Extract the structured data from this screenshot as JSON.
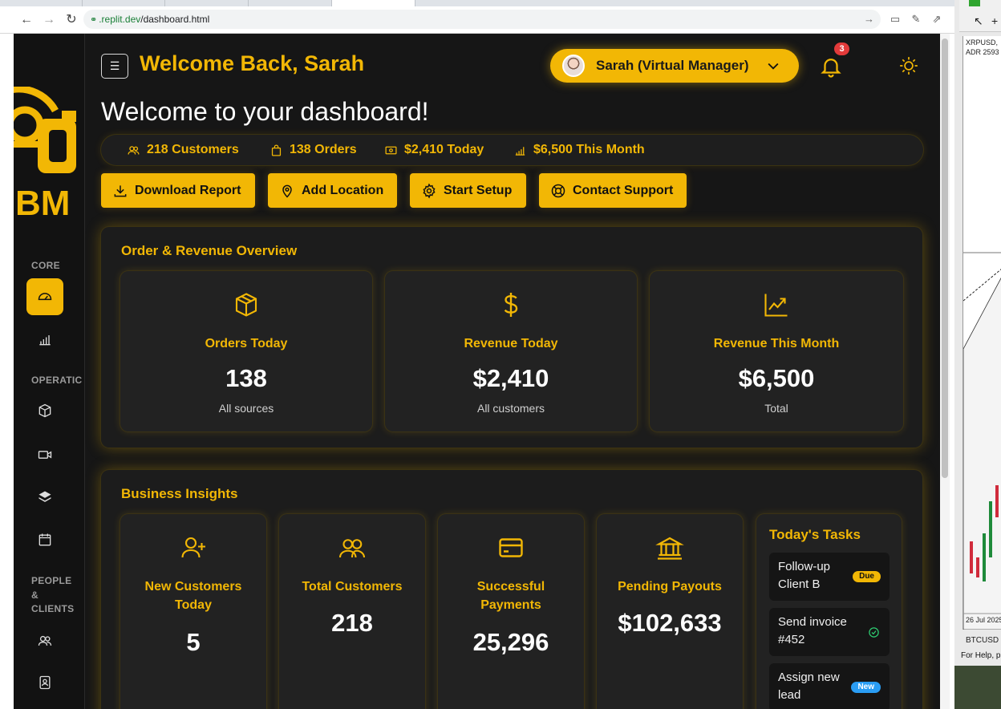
{
  "browser": {
    "url_host": ".replit.dev",
    "url_path": "/dashboard.html"
  },
  "header": {
    "welcome": "Welcome Back, Sarah",
    "user_name": "Sarah (Virtual Manager)",
    "notification_count": "3"
  },
  "sidebar": {
    "brand": "BM",
    "sections": [
      "CORE",
      "OPERATIC",
      "PEOPLE",
      "&",
      "CLIENTS"
    ]
  },
  "dashboard": {
    "title": "Welcome to your dashboard!",
    "stats": {
      "customers": "218 Customers",
      "orders": "138 Orders",
      "today": "$2,410 Today",
      "month": "$6,500 This Month"
    },
    "actions": {
      "download": "Download Report",
      "location": "Add Location",
      "setup": "Start Setup",
      "support": "Contact Support"
    }
  },
  "overview": {
    "title": "Order & Revenue Overview",
    "cards": [
      {
        "label": "Orders Today",
        "value": "138",
        "sub": "All sources"
      },
      {
        "label": "Revenue Today",
        "value": "$2,410",
        "sub": "All customers"
      },
      {
        "label": "Revenue This Month",
        "value": "$6,500",
        "sub": "Total"
      }
    ]
  },
  "insights": {
    "title": "Business Insights",
    "cards": [
      {
        "label1": "New Customers",
        "label2": "Today",
        "value": "5"
      },
      {
        "label1": "Total Customers",
        "label2": "",
        "value": "218"
      },
      {
        "label1": "Successful",
        "label2": "Payments",
        "value": "25,296"
      },
      {
        "label1": "Pending Payouts",
        "label2": "",
        "value": "$102,633"
      }
    ]
  },
  "tasks": {
    "title": "Today's Tasks",
    "items": [
      {
        "line1": "Follow-up",
        "line2": "Client B",
        "badge": "Due"
      },
      {
        "line1": "Send invoice",
        "line2": "#452",
        "badge": ""
      },
      {
        "line1": "Assign new",
        "line2": "lead",
        "badge": "New"
      }
    ]
  },
  "background_window": {
    "symbol": "XRPUSD,",
    "adr": "ADR 2593",
    "date": "26 Jul 2025",
    "tab": "BTCUSD",
    "help": "For Help, p"
  },
  "colors": {
    "accent": "#f2b705",
    "background": "#161616",
    "panel": "#1c1c1c",
    "badge_red": "#e33a3a",
    "badge_blue": "#2a9df4"
  }
}
